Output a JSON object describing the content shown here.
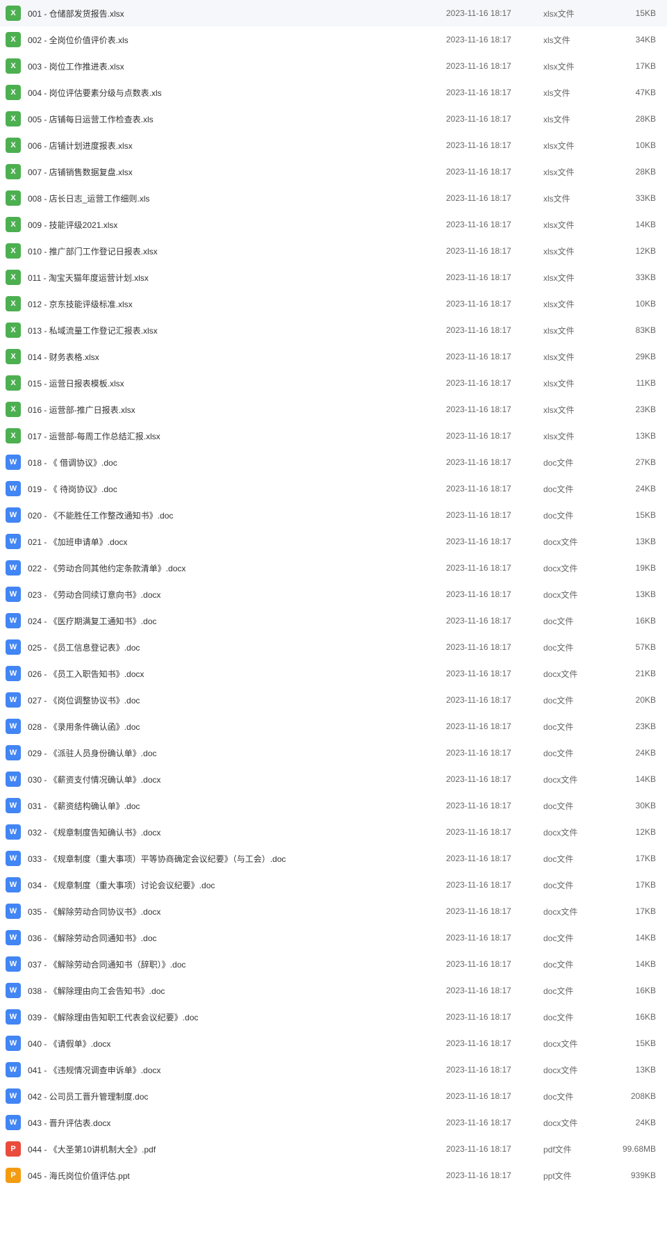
{
  "iconLabels": {
    "xls": "X",
    "doc": "W",
    "pdf": "P",
    "ppt": "P"
  },
  "files": [
    {
      "name": "001 - 仓储部发货报告.xlsx",
      "date": "2023-11-16 18:17",
      "type": "xlsx文件",
      "size": "15KB",
      "iconClass": "icon-xls",
      "iconKey": "xls"
    },
    {
      "name": "002 - 全岗位价值评价表.xls",
      "date": "2023-11-16 18:17",
      "type": "xls文件",
      "size": "34KB",
      "iconClass": "icon-xls",
      "iconKey": "xls"
    },
    {
      "name": "003 - 岗位工作推进表.xlsx",
      "date": "2023-11-16 18:17",
      "type": "xlsx文件",
      "size": "17KB",
      "iconClass": "icon-xls",
      "iconKey": "xls"
    },
    {
      "name": "004 - 岗位评估要素分级与点数表.xls",
      "date": "2023-11-16 18:17",
      "type": "xls文件",
      "size": "47KB",
      "iconClass": "icon-xls",
      "iconKey": "xls"
    },
    {
      "name": "005 - 店铺每日运营工作检查表.xls",
      "date": "2023-11-16 18:17",
      "type": "xls文件",
      "size": "28KB",
      "iconClass": "icon-xls",
      "iconKey": "xls"
    },
    {
      "name": "006 - 店铺计划进度报表.xlsx",
      "date": "2023-11-16 18:17",
      "type": "xlsx文件",
      "size": "10KB",
      "iconClass": "icon-xls",
      "iconKey": "xls"
    },
    {
      "name": "007 - 店铺销售数据复盘.xlsx",
      "date": "2023-11-16 18:17",
      "type": "xlsx文件",
      "size": "28KB",
      "iconClass": "icon-xls",
      "iconKey": "xls"
    },
    {
      "name": "008 - 店长日志_运营工作细则.xls",
      "date": "2023-11-16 18:17",
      "type": "xls文件",
      "size": "33KB",
      "iconClass": "icon-xls",
      "iconKey": "xls"
    },
    {
      "name": "009 - 技能评级2021.xlsx",
      "date": "2023-11-16 18:17",
      "type": "xlsx文件",
      "size": "14KB",
      "iconClass": "icon-xls",
      "iconKey": "xls"
    },
    {
      "name": "010 - 推广部门工作登记日报表.xlsx",
      "date": "2023-11-16 18:17",
      "type": "xlsx文件",
      "size": "12KB",
      "iconClass": "icon-xls",
      "iconKey": "xls"
    },
    {
      "name": "011 - 淘宝天猫年度运营计划.xlsx",
      "date": "2023-11-16 18:17",
      "type": "xlsx文件",
      "size": "33KB",
      "iconClass": "icon-xls",
      "iconKey": "xls"
    },
    {
      "name": "012 - 京东技能评级标准.xlsx",
      "date": "2023-11-16 18:17",
      "type": "xlsx文件",
      "size": "10KB",
      "iconClass": "icon-xls",
      "iconKey": "xls"
    },
    {
      "name": "013 - 私域流量工作登记汇报表.xlsx",
      "date": "2023-11-16 18:17",
      "type": "xlsx文件",
      "size": "83KB",
      "iconClass": "icon-xls",
      "iconKey": "xls"
    },
    {
      "name": "014 - 财务表格.xlsx",
      "date": "2023-11-16 18:17",
      "type": "xlsx文件",
      "size": "29KB",
      "iconClass": "icon-xls",
      "iconKey": "xls"
    },
    {
      "name": "015 - 运营日报表模板.xlsx",
      "date": "2023-11-16 18:17",
      "type": "xlsx文件",
      "size": "11KB",
      "iconClass": "icon-xls",
      "iconKey": "xls"
    },
    {
      "name": "016 - 运营部-推广日报表.xlsx",
      "date": "2023-11-16 18:17",
      "type": "xlsx文件",
      "size": "23KB",
      "iconClass": "icon-xls",
      "iconKey": "xls"
    },
    {
      "name": "017 - 运营部-每周工作总结汇报.xlsx",
      "date": "2023-11-16 18:17",
      "type": "xlsx文件",
      "size": "13KB",
      "iconClass": "icon-xls",
      "iconKey": "xls"
    },
    {
      "name": "018 - 《 借调协议》.doc",
      "date": "2023-11-16 18:17",
      "type": "doc文件",
      "size": "27KB",
      "iconClass": "icon-doc",
      "iconKey": "doc"
    },
    {
      "name": "019 - 《 待岗协议》.doc",
      "date": "2023-11-16 18:17",
      "type": "doc文件",
      "size": "24KB",
      "iconClass": "icon-doc",
      "iconKey": "doc"
    },
    {
      "name": "020 - 《不能胜任工作整改通知书》.doc",
      "date": "2023-11-16 18:17",
      "type": "doc文件",
      "size": "15KB",
      "iconClass": "icon-doc",
      "iconKey": "doc"
    },
    {
      "name": "021 - 《加班申请单》.docx",
      "date": "2023-11-16 18:17",
      "type": "docx文件",
      "size": "13KB",
      "iconClass": "icon-doc",
      "iconKey": "doc"
    },
    {
      "name": "022 - 《劳动合同其他约定条款清单》.docx",
      "date": "2023-11-16 18:17",
      "type": "docx文件",
      "size": "19KB",
      "iconClass": "icon-doc",
      "iconKey": "doc"
    },
    {
      "name": "023 - 《劳动合同续订意向书》.docx",
      "date": "2023-11-16 18:17",
      "type": "docx文件",
      "size": "13KB",
      "iconClass": "icon-doc",
      "iconKey": "doc"
    },
    {
      "name": "024 - 《医疗期满复工通知书》.doc",
      "date": "2023-11-16 18:17",
      "type": "doc文件",
      "size": "16KB",
      "iconClass": "icon-doc",
      "iconKey": "doc"
    },
    {
      "name": "025 - 《员工信息登记表》.doc",
      "date": "2023-11-16 18:17",
      "type": "doc文件",
      "size": "57KB",
      "iconClass": "icon-doc",
      "iconKey": "doc"
    },
    {
      "name": "026 - 《员工入职告知书》.docx",
      "date": "2023-11-16 18:17",
      "type": "docx文件",
      "size": "21KB",
      "iconClass": "icon-doc",
      "iconKey": "doc"
    },
    {
      "name": "027 - 《岗位调整协议书》.doc",
      "date": "2023-11-16 18:17",
      "type": "doc文件",
      "size": "20KB",
      "iconClass": "icon-doc",
      "iconKey": "doc"
    },
    {
      "name": "028 - 《录用条件确认函》.doc",
      "date": "2023-11-16 18:17",
      "type": "doc文件",
      "size": "23KB",
      "iconClass": "icon-doc",
      "iconKey": "doc"
    },
    {
      "name": "029 - 《派驻人员身份确认单》.doc",
      "date": "2023-11-16 18:17",
      "type": "doc文件",
      "size": "24KB",
      "iconClass": "icon-doc",
      "iconKey": "doc"
    },
    {
      "name": "030 - 《薪资支付情况确认单》.docx",
      "date": "2023-11-16 18:17",
      "type": "docx文件",
      "size": "14KB",
      "iconClass": "icon-doc",
      "iconKey": "doc"
    },
    {
      "name": "031 - 《薪资结构确认单》.doc",
      "date": "2023-11-16 18:17",
      "type": "doc文件",
      "size": "30KB",
      "iconClass": "icon-doc",
      "iconKey": "doc"
    },
    {
      "name": "032 - 《规章制度告知确认书》.docx",
      "date": "2023-11-16 18:17",
      "type": "docx文件",
      "size": "12KB",
      "iconClass": "icon-doc",
      "iconKey": "doc"
    },
    {
      "name": "033 - 《规章制度（重大事项）平等协商确定会议纪要》（与工会）.doc",
      "date": "2023-11-16 18:17",
      "type": "doc文件",
      "size": "17KB",
      "iconClass": "icon-doc",
      "iconKey": "doc"
    },
    {
      "name": "034 - 《规章制度（重大事项）讨论会议纪要》.doc",
      "date": "2023-11-16 18:17",
      "type": "doc文件",
      "size": "17KB",
      "iconClass": "icon-doc",
      "iconKey": "doc"
    },
    {
      "name": "035 - 《解除劳动合同协议书》.docx",
      "date": "2023-11-16 18:17",
      "type": "docx文件",
      "size": "17KB",
      "iconClass": "icon-doc",
      "iconKey": "doc"
    },
    {
      "name": "036 - 《解除劳动合同通知书》.doc",
      "date": "2023-11-16 18:17",
      "type": "doc文件",
      "size": "14KB",
      "iconClass": "icon-doc",
      "iconKey": "doc"
    },
    {
      "name": "037 - 《解除劳动合同通知书（辞职）》.doc",
      "date": "2023-11-16 18:17",
      "type": "doc文件",
      "size": "14KB",
      "iconClass": "icon-doc",
      "iconKey": "doc"
    },
    {
      "name": "038 - 《解除理由向工会告知书》.doc",
      "date": "2023-11-16 18:17",
      "type": "doc文件",
      "size": "16KB",
      "iconClass": "icon-doc",
      "iconKey": "doc"
    },
    {
      "name": "039 - 《解除理由告知职工代表会议纪要》.doc",
      "date": "2023-11-16 18:17",
      "type": "doc文件",
      "size": "16KB",
      "iconClass": "icon-doc",
      "iconKey": "doc"
    },
    {
      "name": "040 - 《请假单》.docx",
      "date": "2023-11-16 18:17",
      "type": "docx文件",
      "size": "15KB",
      "iconClass": "icon-doc",
      "iconKey": "doc"
    },
    {
      "name": "041 - 《违规情况调查申诉单》.docx",
      "date": "2023-11-16 18:17",
      "type": "docx文件",
      "size": "13KB",
      "iconClass": "icon-doc",
      "iconKey": "doc"
    },
    {
      "name": "042 - 公司员工晋升管理制度.doc",
      "date": "2023-11-16 18:17",
      "type": "doc文件",
      "size": "208KB",
      "iconClass": "icon-doc",
      "iconKey": "doc"
    },
    {
      "name": "043 - 晋升评估表.docx",
      "date": "2023-11-16 18:17",
      "type": "docx文件",
      "size": "24KB",
      "iconClass": "icon-doc",
      "iconKey": "doc"
    },
    {
      "name": "044 - 《大圣第10讲机制大全》.pdf",
      "date": "2023-11-16 18:17",
      "type": "pdf文件",
      "size": "99.68MB",
      "iconClass": "icon-pdf",
      "iconKey": "pdf"
    },
    {
      "name": "045 - 海氏岗位价值评估.ppt",
      "date": "2023-11-16 18:17",
      "type": "ppt文件",
      "size": "939KB",
      "iconClass": "icon-ppt",
      "iconKey": "ppt"
    }
  ]
}
